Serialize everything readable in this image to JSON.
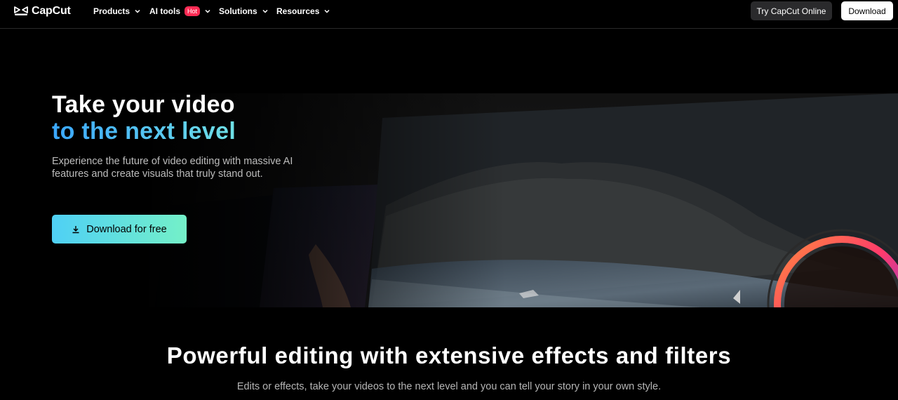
{
  "nav": {
    "logo_text": "CapCut",
    "items": [
      {
        "label": "Products"
      },
      {
        "label": "AI tools",
        "badge": "Hot"
      },
      {
        "label": "Solutions"
      },
      {
        "label": "Resources"
      }
    ],
    "try_online_label": "Try CapCut Online",
    "download_label": "Download"
  },
  "hero": {
    "title_line1": "Take your video",
    "title_line2": "to the next level",
    "subtitle": "Experience the future of video editing with massive AI features and create visuals that truly stand out.",
    "cta_label": "Download for free"
  },
  "section": {
    "title": "Powerful editing with extensive effects and filters",
    "subtitle": "Edits or effects, take your videos to the next level and you can tell your story in your own style."
  },
  "colors": {
    "accent_gradient_start": "#4fd0f5",
    "accent_gradient_end": "#74f0c8",
    "hot_badge": "#fe2c55",
    "title_gradient_start": "#3aa7ff",
    "title_gradient_end": "#6fe0e6"
  },
  "icons": [
    "capcut-logo-icon",
    "chevron-down-icon",
    "download-icon"
  ]
}
